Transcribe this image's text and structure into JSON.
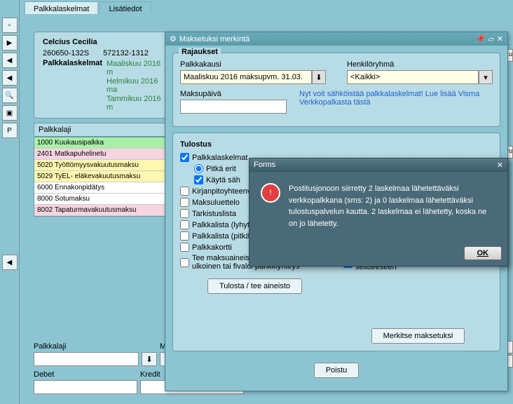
{
  "tabs": {
    "palkkalaskelmat": "Palkkalaskelmat",
    "lisatiedot": "Lisätiedot"
  },
  "person": {
    "name": "Celcius Cecilia",
    "id1": "260650-132S",
    "id2": "572132-1312",
    "label_laskelmat": "Palkkalaskelmat",
    "periods": [
      "Maaliskuu 2016 m",
      "Helmikuu 2016 ma",
      "Tammikuu 2016 m"
    ]
  },
  "palkkalaji": {
    "header": "Palkkalaji",
    "items": [
      {
        "text": "1000 Kuukausipalkka",
        "cls": "pl-green"
      },
      {
        "text": "2401 Matkapuhelinetu",
        "cls": "pl-pink"
      },
      {
        "text": "5020 Työttömyysvakuutusmaksu",
        "cls": "pl-yellow"
      },
      {
        "text": "5029 TyEL- eläkevakuutusmaksu",
        "cls": "pl-yellow"
      },
      {
        "text": "6000 Ennakonpidätys",
        "cls": "pl-white"
      },
      {
        "text": "8000 Sotumaksu",
        "cls": "pl-white"
      },
      {
        "text": "8002 Tapaturmavakuutusmaksu",
        "cls": "pl-pink"
      }
    ]
  },
  "bottom": {
    "palkkalaji": "Palkkalaji",
    "m": "M",
    "debet": "Debet",
    "kredit": "Kredit"
  },
  "dialog": {
    "title": "Maksetuksi merkintä",
    "rajaukset": "Rajaukset",
    "palkkakausi": "Palkkakausi",
    "palkkakausi_val": "Maaliskuu 2016 maksupvm. 31.03.",
    "henkiloryhma": "Henkilöryhmä",
    "henkiloryhma_val": "<Kaikki>",
    "maksupaiva": "Maksupäivä",
    "link": "Nyt voit sähköistää palkkalaskelmat! Lue lisää Visma Verkkopalkasta tästä",
    "tulostus": "Tulostus",
    "opts": {
      "palkkalaskelmat": "Palkkalaskelmat",
      "pitka": "Pitkä erit",
      "kayta": "Käytä säh",
      "kirjanpito": "Kirjanpitoyhteenveto",
      "maksuluettelo": "Maksuluettelo",
      "tarkistuslista": "Tarkistuslista",
      "palkkalista_lyhyt": "Palkkalista (lyhyt)",
      "palkkalista_pitka": "Palkkalista (pitkä)",
      "palkkakortti": "Palkkakortti",
      "tee_maksu": "Tee maksuaineisto ,\nulkoinen tai fivaldi pankkiyhteys",
      "selite": "Palkkakauden selite kirjanpidon selitteeseen"
    },
    "btn_tulosta": "Tulosta / tee aineisto",
    "btn_merkitse": "Merkitse maksetuksi",
    "btn_poistu": "Poistu"
  },
  "forms": {
    "title": "Forms",
    "msg": "Postitusjonoon siirretty 2 laskelmaa lähetettäväksi verkkopalkkana (sms: 2) ja 0 laskelmaa lähetettäväksi tulostuspalvelun kautta. 2 laskelmaa ei lähetetty, koska ne on jo lähetetty.",
    "ok": "OK"
  },
  "right": {
    "ku": "Ku",
    "pu": "Pu"
  }
}
